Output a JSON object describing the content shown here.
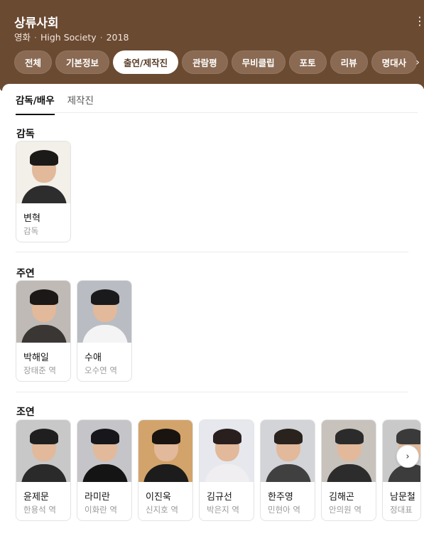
{
  "header": {
    "title": "상류사회",
    "meta": [
      "영화",
      "High Society",
      "2018"
    ],
    "more_icon": "⋮",
    "bg": "#6b4a32"
  },
  "tabs": [
    {
      "label": "전체",
      "active": false
    },
    {
      "label": "기본정보",
      "active": false
    },
    {
      "label": "출연/제작진",
      "active": true
    },
    {
      "label": "관람평",
      "active": false
    },
    {
      "label": "무비클립",
      "active": false
    },
    {
      "label": "포토",
      "active": false
    },
    {
      "label": "리뷰",
      "active": false
    },
    {
      "label": "명대사",
      "active": false
    }
  ],
  "tabs_chevron": "›",
  "subtabs": [
    {
      "label": "감독/배우",
      "active": true
    },
    {
      "label": "제작진",
      "active": false
    }
  ],
  "sections": {
    "director": {
      "title": "감독",
      "people": [
        {
          "name": "변혁",
          "role": "감독",
          "bg": "#f3efe9",
          "hair": "#1b1a19",
          "body": "#2d2d2d"
        }
      ]
    },
    "lead": {
      "title": "주연",
      "people": [
        {
          "name": "박해일",
          "role": "장태준 역",
          "bg": "#bfbab6",
          "hair": "#1b1817",
          "body": "#3a3634"
        },
        {
          "name": "수애",
          "role": "오수연 역",
          "bg": "#b9bcc2",
          "hair": "#1a1a1c",
          "body": "#f4f4f4"
        }
      ]
    },
    "supporting": {
      "title": "조연",
      "people": [
        {
          "name": "윤제문",
          "role": "한용석 역",
          "bg": "#c8c8c8",
          "hair": "#1f1f1f",
          "body": "#2a2a2a"
        },
        {
          "name": "라미란",
          "role": "이화란 역",
          "bg": "#c5c4c8",
          "hair": "#17161a",
          "body": "#141414"
        },
        {
          "name": "이진욱",
          "role": "신지호 역",
          "bg": "#d2a36a",
          "hair": "#1a1410",
          "body": "#1c1c1c"
        },
        {
          "name": "김규선",
          "role": "박은지 역",
          "bg": "#e6e8ee",
          "hair": "#2a1f1f",
          "body": "#f0eef0"
        },
        {
          "name": "한주영",
          "role": "민현아 역",
          "bg": "#d2d4d8",
          "hair": "#2a221c",
          "body": "#404040"
        },
        {
          "name": "김해곤",
          "role": "안의원 역",
          "bg": "#c8c2bc",
          "hair": "#2b2b2b",
          "body": "#2c2c2c"
        },
        {
          "name": "남문철",
          "role": "정대표",
          "bg": "#c9c9c9",
          "hair": "#3a3a3a",
          "body": "#3c3c3c"
        }
      ]
    }
  },
  "next_button_icon": "›"
}
